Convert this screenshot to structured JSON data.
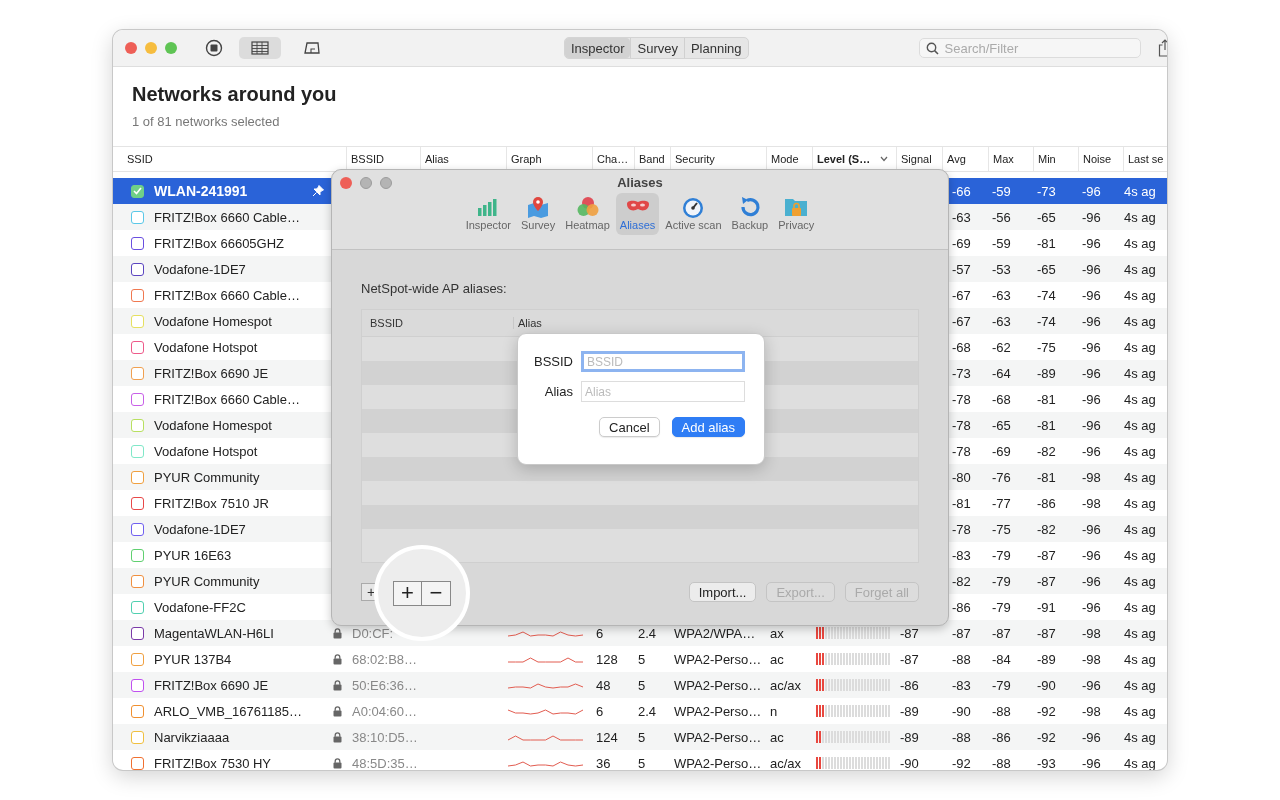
{
  "toolbar": {
    "view_tabs": [
      {
        "label": "Inspector",
        "selected": true
      },
      {
        "label": "Survey",
        "selected": false
      },
      {
        "label": "Planning",
        "selected": false
      }
    ],
    "search": {
      "placeholder": "Search/Filter"
    }
  },
  "header": {
    "title": "Networks around you",
    "subtitle": "1 of 81 networks selected"
  },
  "table": {
    "columns": [
      "SSID",
      "BSSID",
      "Alias",
      "Graph",
      "Cha…",
      "Band",
      "Security",
      "Mode",
      "Level (S…",
      "Signal",
      "Avg",
      "Max",
      "Min",
      "Noise",
      "Last se"
    ],
    "rows": [
      {
        "ssid": "WLAN-241991",
        "color": "#6fcf87",
        "checked": true,
        "selected": true,
        "pinned": true,
        "avg": "-66",
        "max": "-59",
        "min": "-73",
        "noise": "-96",
        "last_seen": "4s ag"
      },
      {
        "ssid": "FRITZ!Box 6660 Cable…",
        "color": "#5ac8e8",
        "checked": false,
        "selected": false,
        "pinned": false,
        "avg": "-63",
        "max": "-56",
        "min": "-65",
        "noise": "-96",
        "last_seen": "4s ag"
      },
      {
        "ssid": "FRITZ!Box 66605GHZ",
        "color": "#6a4fe0",
        "checked": false,
        "selected": false,
        "pinned": false,
        "avg": "-69",
        "max": "-59",
        "min": "-81",
        "noise": "-96",
        "last_seen": "4s ag"
      },
      {
        "ssid": "Vodafone-1DE7",
        "color": "#5b45c0",
        "checked": false,
        "selected": false,
        "pinned": false,
        "avg": "-57",
        "max": "-53",
        "min": "-65",
        "noise": "-96",
        "last_seen": "4s ag"
      },
      {
        "ssid": "FRITZ!Box 6660 Cable…",
        "color": "#f07850",
        "checked": false,
        "selected": false,
        "pinned": false,
        "avg": "-67",
        "max": "-63",
        "min": "-74",
        "noise": "-96",
        "last_seen": "4s ag"
      },
      {
        "ssid": "Vodafone Homespot",
        "color": "#e6e060",
        "checked": false,
        "selected": false,
        "pinned": false,
        "avg": "-67",
        "max": "-63",
        "min": "-74",
        "noise": "-96",
        "last_seen": "4s ag"
      },
      {
        "ssid": "Vodafone Hotspot",
        "color": "#ee5a8a",
        "checked": false,
        "selected": false,
        "pinned": false,
        "avg": "-68",
        "max": "-62",
        "min": "-75",
        "noise": "-96",
        "last_seen": "4s ag"
      },
      {
        "ssid": "FRITZ!Box 6690 JE",
        "color": "#f0a050",
        "checked": false,
        "selected": false,
        "pinned": false,
        "avg": "-73",
        "max": "-64",
        "min": "-89",
        "noise": "-96",
        "last_seen": "4s ag"
      },
      {
        "ssid": "FRITZ!Box 6660 Cable…",
        "color": "#c860e8",
        "checked": false,
        "selected": false,
        "pinned": false,
        "avg": "-78",
        "max": "-68",
        "min": "-81",
        "noise": "-96",
        "last_seen": "4s ag"
      },
      {
        "ssid": "Vodafone Homespot",
        "color": "#b8e060",
        "checked": false,
        "selected": false,
        "pinned": false,
        "avg": "-78",
        "max": "-65",
        "min": "-81",
        "noise": "-96",
        "last_seen": "4s ag"
      },
      {
        "ssid": "Vodafone Hotspot",
        "color": "#80e8c8",
        "checked": false,
        "selected": false,
        "pinned": false,
        "avg": "-78",
        "max": "-69",
        "min": "-82",
        "noise": "-96",
        "last_seen": "4s ag"
      },
      {
        "ssid": "PYUR Community",
        "color": "#f0a040",
        "checked": false,
        "selected": false,
        "pinned": false,
        "avg": "-80",
        "max": "-76",
        "min": "-81",
        "noise": "-98",
        "last_seen": "4s ag"
      },
      {
        "ssid": "FRITZ!Box 7510 JR",
        "color": "#e84848",
        "checked": false,
        "selected": false,
        "pinned": false,
        "avg": "-81",
        "max": "-77",
        "min": "-86",
        "noise": "-98",
        "last_seen": "4s ag"
      },
      {
        "ssid": "Vodafone-1DE7",
        "color": "#7060f0",
        "checked": false,
        "selected": false,
        "pinned": false,
        "avg": "-78",
        "max": "-75",
        "min": "-82",
        "noise": "-96",
        "last_seen": "4s ag"
      },
      {
        "ssid": "PYUR 16E63",
        "color": "#60d070",
        "checked": false,
        "selected": false,
        "pinned": false,
        "avg": "-83",
        "max": "-79",
        "min": "-87",
        "noise": "-96",
        "last_seen": "4s ag"
      },
      {
        "ssid": "PYUR Community",
        "color": "#f09040",
        "checked": false,
        "selected": false,
        "pinned": false,
        "avg": "-82",
        "max": "-79",
        "min": "-87",
        "noise": "-96",
        "last_seen": "4s ag"
      },
      {
        "ssid": "Vodafone-FF2C",
        "color": "#50d0b0",
        "checked": false,
        "selected": false,
        "pinned": false,
        "avg": "-86",
        "max": "-79",
        "min": "-91",
        "noise": "-96",
        "last_seen": "4s ag"
      },
      {
        "ssid": "MagentaWLAN-H6LI",
        "color": "#7a3aa8",
        "checked": false,
        "selected": false,
        "pinned": false,
        "secured": true,
        "bssid": "D0:CF:",
        "channel": "6",
        "band": "2.4",
        "security": "WPA2/WPA…",
        "mode": "ax",
        "level": 0.12,
        "signal": "-87",
        "avg": "-87",
        "max": "-87",
        "min": "-87",
        "noise": "-98",
        "last_seen": "4s ag"
      },
      {
        "ssid": "PYUR 137B4",
        "color": "#f0a040",
        "checked": false,
        "selected": false,
        "pinned": false,
        "secured": true,
        "bssid": "68:02:B8…",
        "channel": "128",
        "band": "5",
        "security": "WPA2-Perso…",
        "mode": "ac",
        "level": 0.12,
        "signal": "-87",
        "avg": "-88",
        "max": "-84",
        "min": "-89",
        "noise": "-98",
        "last_seen": "4s ag"
      },
      {
        "ssid": "FRITZ!Box 6690 JE",
        "color": "#c050f0",
        "checked": false,
        "selected": false,
        "pinned": false,
        "secured": true,
        "bssid": "50:E6:36…",
        "channel": "48",
        "band": "5",
        "security": "WPA2-Perso…",
        "mode": "ac/ax",
        "level": 0.12,
        "signal": "-86",
        "avg": "-83",
        "max": "-79",
        "min": "-90",
        "noise": "-96",
        "last_seen": "4s ag"
      },
      {
        "ssid": "ARLO_VMB_16761185…",
        "color": "#f09030",
        "checked": false,
        "selected": false,
        "pinned": false,
        "secured": true,
        "bssid": "A0:04:60…",
        "channel": "6",
        "band": "2.4",
        "security": "WPA2-Perso…",
        "mode": "n",
        "level": 0.12,
        "signal": "-89",
        "avg": "-90",
        "max": "-88",
        "min": "-92",
        "noise": "-98",
        "last_seen": "4s ag"
      },
      {
        "ssid": "Narvikziaaaa",
        "color": "#f0c040",
        "checked": false,
        "selected": false,
        "pinned": false,
        "secured": true,
        "bssid": "38:10:D5…",
        "channel": "124",
        "band": "5",
        "security": "WPA2-Perso…",
        "mode": "ac",
        "level": 0.08,
        "signal": "-89",
        "avg": "-88",
        "max": "-86",
        "min": "-92",
        "noise": "-96",
        "last_seen": "4s ag"
      },
      {
        "ssid": "FRITZ!Box 7530 HY",
        "color": "#f07030",
        "checked": false,
        "selected": false,
        "pinned": false,
        "secured": true,
        "bssid": "48:5D:35…",
        "channel": "36",
        "band": "5",
        "security": "WPA2-Perso…",
        "mode": "ac/ax",
        "level": 0.08,
        "signal": "-90",
        "avg": "-92",
        "max": "-88",
        "min": "-93",
        "noise": "-96",
        "last_seen": "4s ag"
      }
    ]
  },
  "preferences": {
    "title": "Aliases",
    "tabs": [
      {
        "label": "Inspector",
        "selected": false
      },
      {
        "label": "Survey",
        "selected": false
      },
      {
        "label": "Heatmap",
        "selected": false
      },
      {
        "label": "Aliases",
        "selected": true
      },
      {
        "label": "Active scan",
        "selected": false
      },
      {
        "label": "Backup",
        "selected": false
      },
      {
        "label": "Privacy",
        "selected": false
      }
    ],
    "section_label": "NetSpot-wide AP aliases:",
    "alias_columns": [
      "BSSID",
      "Alias"
    ],
    "add_button": "+",
    "magnified_buttons": [
      "+",
      "−"
    ],
    "buttons": [
      {
        "label": "Import...",
        "disabled": false
      },
      {
        "label": "Export...",
        "disabled": true
      },
      {
        "label": "Forget all",
        "disabled": true
      }
    ],
    "sheet": {
      "fields": [
        {
          "label": "BSSID",
          "placeholder": "BSSID",
          "focused": true
        },
        {
          "label": "Alias",
          "placeholder": "Alias",
          "focused": false
        }
      ],
      "buttons": [
        {
          "label": "Cancel",
          "primary": false
        },
        {
          "label": "Add alias",
          "primary": true
        }
      ]
    }
  }
}
